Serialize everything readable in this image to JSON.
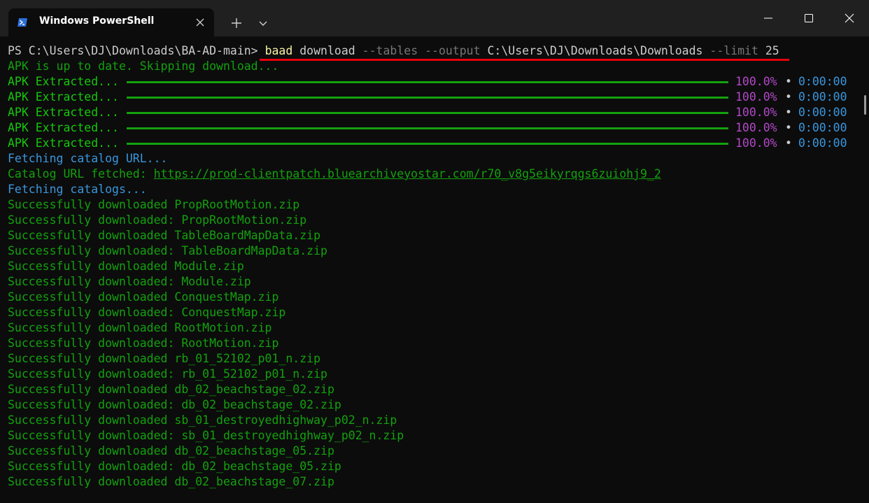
{
  "window": {
    "tab_title": "Windows PowerShell",
    "new_tab_glyph": "+",
    "icons": [
      "powershell-icon",
      "close-icon",
      "plus-icon",
      "chevron-down-icon",
      "minimize-icon",
      "maximize-icon",
      "close-icon"
    ]
  },
  "prompt": {
    "ps": "PS C:\\Users\\DJ\\Downloads\\BA-AD-main> ",
    "cmd": "baad",
    "arg1": " download ",
    "flag1": "--tables",
    "space1": " ",
    "flag2": "--output",
    "arg2": " C:\\Users\\DJ\\Downloads\\Downloads ",
    "flag3": "--limit",
    "arg3": " 25"
  },
  "apk_status": "APK is up to date. Skipping download...",
  "progress": {
    "label": "APK Extracted...",
    "percent_text": "100.0%",
    "dot": "•",
    "time": "0:00:00",
    "value": 1.0
  },
  "fetching_catalog_url": "Fetching catalog URL...",
  "catalog_fetched_label": "Catalog URL fetched: ",
  "catalog_url": "https://prod-clientpatch.bluearchiveyostar.com/r70_v8g5eikyrqgs6zuiohj9_2",
  "fetching_catalogs": "Fetching catalogs...",
  "downloads": [
    "Successfully downloaded PropRootMotion.zip",
    "Successfully downloaded: PropRootMotion.zip",
    "Successfully downloaded TableBoardMapData.zip",
    "Successfully downloaded: TableBoardMapData.zip",
    "Successfully downloaded Module.zip",
    "Successfully downloaded: Module.zip",
    "Successfully downloaded ConquestMap.zip",
    "Successfully downloaded: ConquestMap.zip",
    "Successfully downloaded RootMotion.zip",
    "Successfully downloaded: RootMotion.zip",
    "Successfully downloaded rb_01_52102_p01_n.zip",
    "Successfully downloaded: rb_01_52102_p01_n.zip",
    "Successfully downloaded db_02_beachstage_02.zip",
    "Successfully downloaded: db_02_beachstage_02.zip",
    "Successfully downloaded sb_01_destroyedhighway_p02_n.zip",
    "Successfully downloaded: sb_01_destroyedhighway_p02_n.zip",
    "Successfully downloaded db_02_beachstage_05.zip",
    "Successfully downloaded: db_02_beachstage_05.zip",
    "Successfully downloaded db_02_beachstage_07.zip"
  ],
  "colors": {
    "green": "#16c60c",
    "purple": "#b148c6",
    "blue": "#3a96dd",
    "yellow": "#f9f1a5",
    "highlight_underline": "#e8000b"
  }
}
